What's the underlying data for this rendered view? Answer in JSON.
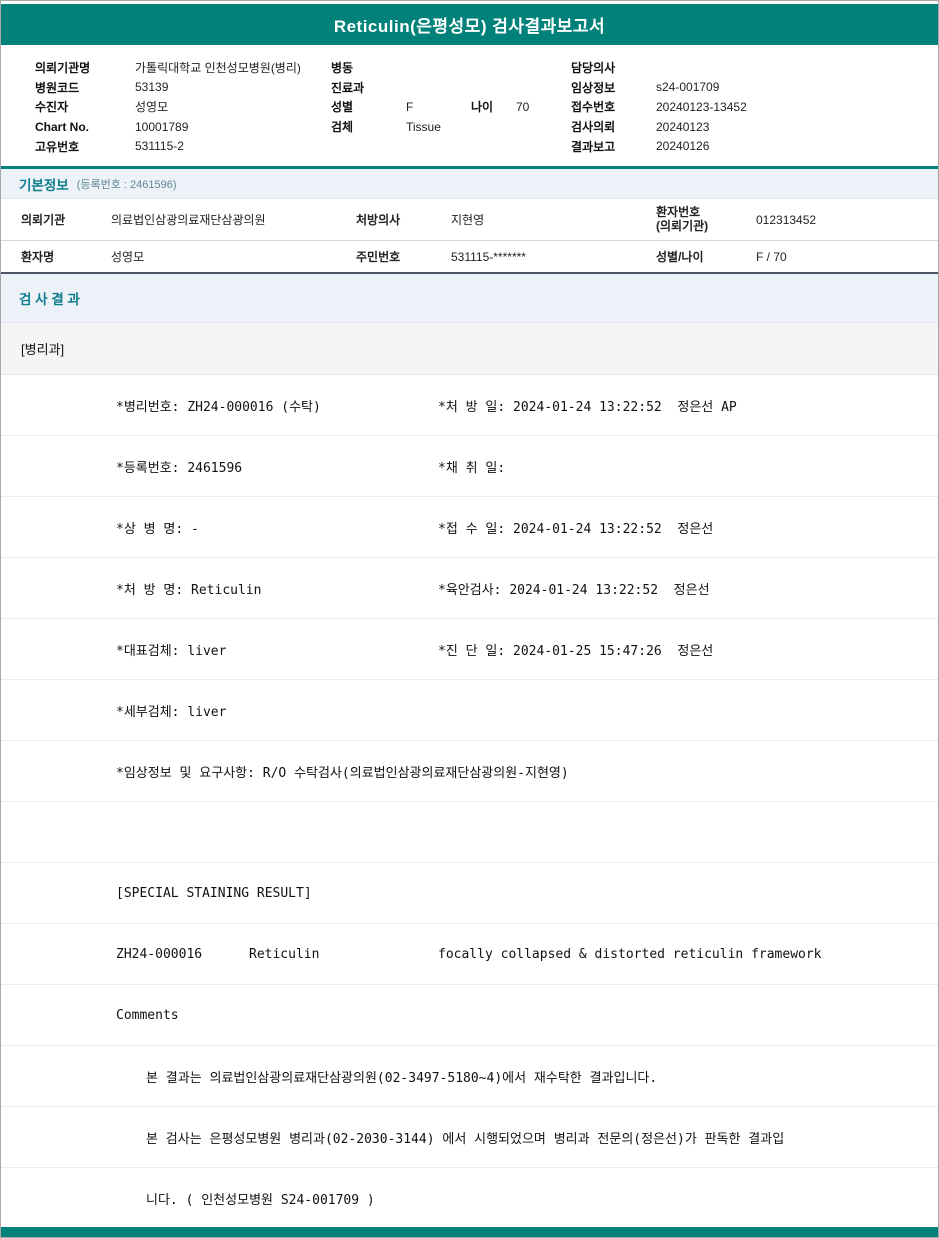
{
  "title": "Reticulin(은평성모) 검사결과보고서",
  "colors": {
    "teal": "#00827B",
    "section_title": "#0E7D8C",
    "section_bg": "#EDF2F8"
  },
  "patient_header": {
    "hospital_name_label": "의뢰기관명",
    "hospital_name": "가톨릭대학교 인천성모병원(병리)",
    "hospital_code_label": "병원코드",
    "hospital_code": "53139",
    "patient_label": "수진자",
    "patient_name": "성영모",
    "chart_no_label": "Chart No.",
    "chart_no": "10001789",
    "unique_no_label": "고유번호",
    "unique_no": "531115-2",
    "ward_label": "병동",
    "ward": "",
    "dept_label": "진료과",
    "dept": "",
    "sex_label": "성별",
    "sex": "F",
    "age_label": "나이",
    "age": "70",
    "specimen_label": "검체",
    "specimen": "Tissue",
    "doctor_label": "담당의사",
    "doctor": "",
    "clinical_info_label": "임상정보",
    "clinical_info": "s24-001709",
    "receipt_no_label": "접수번호",
    "receipt_no": "20240123-13452",
    "request_date_label": "검사의뢰",
    "request_date": "20240123",
    "report_date_label": "결과보고",
    "report_date": "20240126"
  },
  "basic_info": {
    "title": "기본정보",
    "subtitle": "(등록번호 : 2461596)",
    "row1": {
      "c1_label": "의뢰기관",
      "c1_value": "의료법인삼광의료재단삼광의원",
      "c2_label": "처방의사",
      "c2_value": "지현영",
      "c3_label_line1": "환자번호",
      "c3_label_line2": "(의뢰기관)",
      "c3_value": "012313452"
    },
    "row2": {
      "c1_label": "환자명",
      "c1_value": "성영모",
      "c2_label": "주민번호",
      "c2_value": "531115-*******",
      "c3_label": "성별/나이",
      "c3_value": "F / 70"
    }
  },
  "results": {
    "title": "검 사 결 과",
    "department": "[병리과]",
    "lines": [
      {
        "left": "*병리번호: ZH24-000016 (수탁)",
        "right": "*처 방 일: 2024-01-24 13:22:52  정은선 AP"
      },
      {
        "left": "*등록번호: 2461596",
        "right": "*채 취 일:"
      },
      {
        "left": "*상 병 명: -",
        "right": "*접 수 일: 2024-01-24 13:22:52  정은선"
      },
      {
        "left": "*처 방 명: Reticulin",
        "right": "*육안검사: 2024-01-24 13:22:52  정은선"
      },
      {
        "left": "*대표검체: liver",
        "right": "*진 단 일: 2024-01-25 15:47:26  정은선"
      },
      {
        "left": "*세부검체: liver",
        "right": ""
      },
      {
        "left": "*임상정보 및 요구사항: R/O 수탁검사(의료법인삼광의료재단삼광의원-지현영)",
        "right": ""
      }
    ],
    "staining": {
      "header": "[SPECIAL STAINING RESULT]",
      "code": "ZH24-000016",
      "stain": "Reticulin",
      "result": "focally collapsed & distorted reticulin framework",
      "comments_label": "Comments"
    },
    "footnotes": [
      "본 결과는 의료법인삼광의료재단삼광의원(02-3497-5180~4)에서 재수탁한 결과입니다.",
      "본 검사는 은평성모병원 병리과(02-2030-3144) 에서 시행되었으며 병리과 전문의(정은선)가 판독한 결과입",
      "니다. ( 인천성모병원 S24-001709 )"
    ]
  }
}
